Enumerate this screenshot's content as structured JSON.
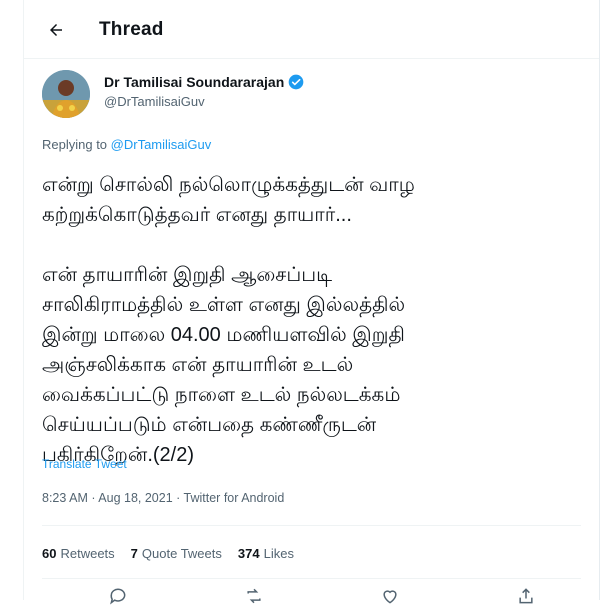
{
  "header": {
    "back_icon": "arrow-left-icon",
    "title": "Thread"
  },
  "author": {
    "name": "Dr Tamilisai Soundararajan",
    "handle": "@DrTamilisaiGuv",
    "verified_color": "#1d9bf0"
  },
  "reply": {
    "prefix": "Replying to ",
    "handle": "@DrTamilisaiGuv"
  },
  "tweet": {
    "text": "என்று சொல்லி நல்லொழுக்கத்துடன் வாழ\nகற்றுக்கொடுத்தவர் எனது தாயார்...\n\nஎன் தாயாரின் இறுதி ஆசைப்படி\nசாலிகிராமத்தில் உள்ள எனது இல்லத்தில்\nஇன்று மாலை 04.00 மணியளவில் இறுதி\nஅஞ்சலிக்காக என் தாயாரின் உடல்\nவைக்கப்பட்டு நாளை உடல் நல்லடக்கம்\nசெய்யப்படும் என்பதை கண்ணீருடன்\nபகிர்கிறேன்.(2/2)"
  },
  "translate_label": "Translate Tweet",
  "meta": "8:23 AM · Aug 18, 2021 · Twitter for Android",
  "stats": {
    "retweets_count": "60",
    "retweets_label": "Retweets",
    "quotes_count": "7",
    "quotes_label": "Quote Tweets",
    "likes_count": "374",
    "likes_label": "Likes"
  },
  "actions": [
    "reply-icon",
    "retweet-icon",
    "like-icon",
    "share-icon"
  ],
  "colors": {
    "accent": "#1d9bf0",
    "muted": "#536471",
    "text": "#0f1419",
    "divider": "#eff3f4"
  }
}
